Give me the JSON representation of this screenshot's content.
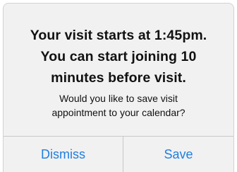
{
  "alert": {
    "title_lines": [
      "Your visit starts at 1:45pm.",
      "You can start joining 10",
      "minutes before visit."
    ],
    "message_lines": [
      "Would you like to save visit",
      "appointment to your calendar?"
    ],
    "buttons": {
      "dismiss": "Dismiss",
      "save": "Save"
    },
    "accent_color": "#1f7fe0"
  }
}
